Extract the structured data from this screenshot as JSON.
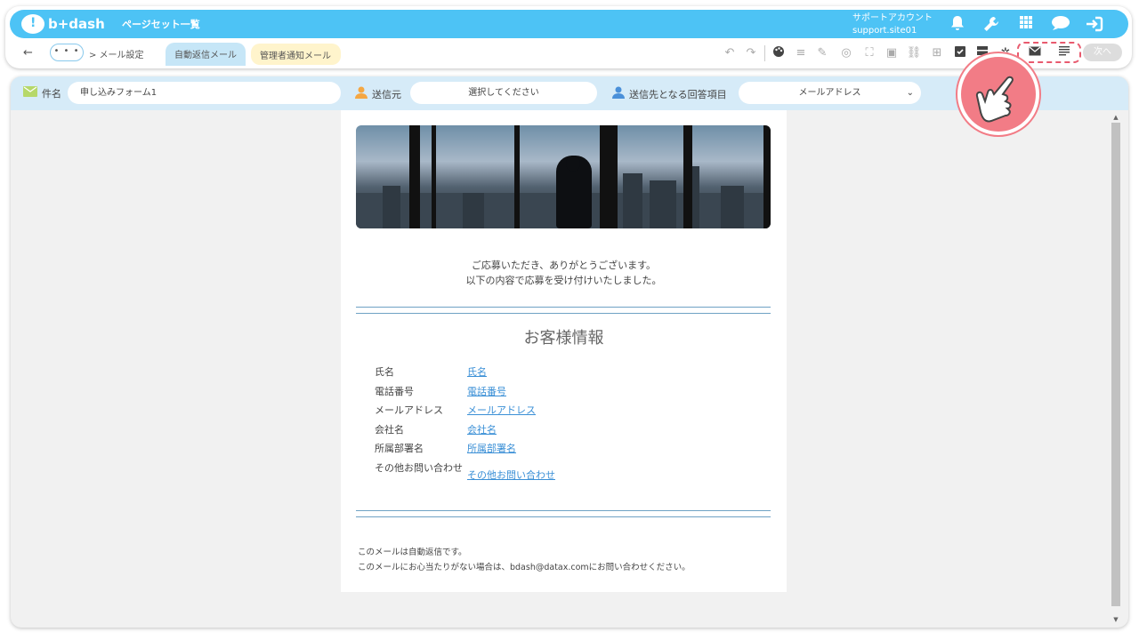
{
  "header": {
    "logo_text": "b+dash",
    "pageset_link": "ページセット一覧",
    "account_name": "サポートアカウント",
    "account_site": "support.site01",
    "icons": [
      "bell-icon",
      "wrench-icon",
      "apps-grid-icon",
      "chat-bubble-icon",
      "logout-icon"
    ]
  },
  "toolbar": {
    "back_symbol": "←",
    "more_label": "• • •",
    "breadcrumb": "> メール設定",
    "tab_auto_reply": "自動返信メール",
    "tab_admin_notice": "管理者通知メール",
    "next_label": "次へ",
    "tool_icons": [
      "undo-icon",
      "redo-icon",
      "palette-icon",
      "align-icon",
      "pen-icon",
      "target-icon",
      "fullscreen-icon",
      "image-icon",
      "link-icon",
      "insert-icon",
      "check-icon",
      "layout-icon",
      "settings-icon",
      "mail-icon",
      "text-icon"
    ]
  },
  "fields": {
    "subject_label": "件名",
    "subject_value": "申し込みフォーム1",
    "sender_label": "送信元",
    "sender_placeholder": "選択してください",
    "recipient_label": "送信先となる回答項目",
    "recipient_value": "メールアドレス"
  },
  "email": {
    "intro_line1": "ご応募いただき、ありがとうございます。",
    "intro_line2": "以下の内容で応募を受け付けいたしました。",
    "section_title": "お客様情報",
    "rows": [
      {
        "key": "氏名",
        "value": "氏名"
      },
      {
        "key": "電話番号",
        "value": "電話番号"
      },
      {
        "key": "メールアドレス",
        "value": "メールアドレス"
      },
      {
        "key": "会社名",
        "value": "会社名"
      },
      {
        "key": "所属部署名",
        "value": "所属部署名"
      },
      {
        "key": "その他お問い合わせ",
        "value": "その他お問い合わせ"
      }
    ],
    "footer_line1": "このメールは自動返信です。",
    "footer_line2": "このメールにお心当たりがない場合は、bdash@datax.comにお問い合わせください。"
  },
  "colors": {
    "brand_blue": "#4dc3f5",
    "highlight_red": "#e85a6e",
    "link_blue": "#3a8fd6",
    "field_bar": "#d6ebf8"
  }
}
